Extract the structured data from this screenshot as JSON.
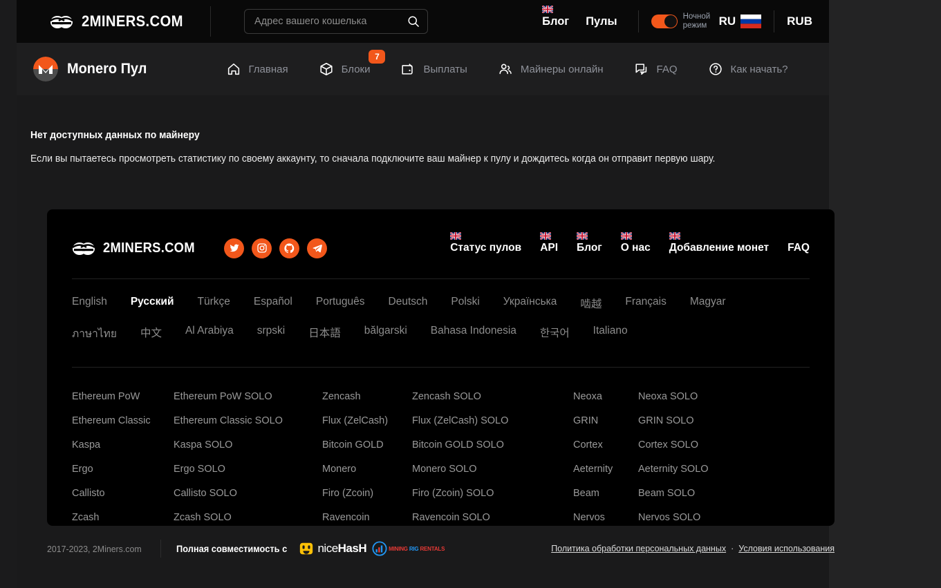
{
  "header": {
    "brand": "2MINERS.COM",
    "search": {
      "placeholder": "Адрес вашего кошелька",
      "value": ""
    },
    "links": [
      {
        "label": "Блог",
        "flag": "uk-flag-icon"
      },
      {
        "label": "Пулы",
        "flag": null
      }
    ],
    "night_mode": {
      "label_line1": "Ночной",
      "label_line2": "режим",
      "enabled": true,
      "accent": "#f2571b"
    },
    "language": "RU",
    "currency": "RUB"
  },
  "nav": {
    "pool_title": "Monero Пул",
    "coin_color": "#f2571b",
    "items": [
      {
        "label": "Главная",
        "icon": "home-icon",
        "badge": null
      },
      {
        "label": "Блоки",
        "icon": "cube-icon",
        "badge": "7"
      },
      {
        "label": "Выплаты",
        "icon": "wallet-icon",
        "badge": null
      },
      {
        "label": "Майнеры онлайн",
        "icon": "users-icon",
        "badge": null
      },
      {
        "label": "FAQ",
        "icon": "chat-icon",
        "badge": null
      },
      {
        "label": "Как начать?",
        "icon": "question-circle-icon",
        "badge": null
      }
    ]
  },
  "main": {
    "title": "Нет доступных данных по майнеру",
    "text": "Если вы пытаетесь просмотреть статистику по своему аккаунту, то сначала подключите ваш майнер к пулу и дождитесь когда он отправит первую шару."
  },
  "footer": {
    "brand": "2MINERS.COM",
    "socials": [
      "twitter-icon",
      "instagram-icon",
      "github-icon",
      "telegram-icon"
    ],
    "links": [
      {
        "label": "Статус пулов",
        "flag": "uk-flag-icon"
      },
      {
        "label": "API",
        "flag": "uk-flag-icon"
      },
      {
        "label": "Блог",
        "flag": "uk-flag-icon"
      },
      {
        "label": "О нас",
        "flag": "uk-flag-icon"
      },
      {
        "label": "Добавление монет",
        "flag": "uk-flag-icon"
      },
      {
        "label": "FAQ",
        "flag": null
      }
    ],
    "languages": [
      {
        "label": "English",
        "active": false
      },
      {
        "label": "Русский",
        "active": true
      },
      {
        "label": "Türkçe",
        "active": false
      },
      {
        "label": "Español",
        "active": false
      },
      {
        "label": "Português",
        "active": false
      },
      {
        "label": "Deutsch",
        "active": false
      },
      {
        "label": "Polski",
        "active": false
      },
      {
        "label": "Українська",
        "active": false
      },
      {
        "label": "啮越",
        "active": false
      },
      {
        "label": "Français",
        "active": false
      },
      {
        "label": "Magyar",
        "active": false
      },
      {
        "label": "ภาษาไทย",
        "active": false
      },
      {
        "label": "中文",
        "active": false
      },
      {
        "label": "Al Arabiya",
        "active": false
      },
      {
        "label": "srpski",
        "active": false
      },
      {
        "label": "日本語",
        "active": false
      },
      {
        "label": "bălgarski",
        "active": false
      },
      {
        "label": "Bahasa Indonesia",
        "active": false
      },
      {
        "label": "한국어",
        "active": false
      },
      {
        "label": "Italiano",
        "active": false
      }
    ],
    "coin_columns": [
      [
        "Ethereum PoW",
        "Ethereum Classic",
        "Kaspa",
        "Ergo",
        "Callisto",
        "Zcash"
      ],
      [
        "Ethereum PoW SOLO",
        "Ethereum Classic SOLO",
        "Kaspa SOLO",
        "Ergo SOLO",
        "Callisto SOLO",
        "Zcash SOLO"
      ],
      [
        "Zencash",
        "Flux (ZelCash)",
        "Bitcoin GOLD",
        "Monero",
        "Firo (Zcoin)",
        "Ravencoin"
      ],
      [
        "Zencash SOLO",
        "Flux (ZelCash) SOLO",
        "Bitcoin GOLD SOLO",
        "Monero SOLO",
        "Firo (Zcoin) SOLO",
        "Ravencoin SOLO"
      ],
      [
        "Neoxa",
        "GRIN",
        "Cortex",
        "Aeternity",
        "Beam",
        "Nervos"
      ],
      [
        "Neoxa SOLO",
        "GRIN SOLO",
        "Cortex SOLO",
        "Aeternity SOLO",
        "Beam SOLO",
        "Nervos SOLO"
      ]
    ]
  },
  "bottom": {
    "copyright": "2017-2023, 2Miners.com",
    "compat_label": "Полная совместимость с",
    "partners": [
      {
        "name": "nicehash-logo",
        "text_light": "nice",
        "text_bold": "HasH"
      },
      {
        "name": "miningrigrentals-logo",
        "text1": "MINING",
        "text2": "RIG",
        "text3": "RENTALS"
      }
    ],
    "legal": [
      {
        "label": "Политика обработки персональных данных"
      },
      {
        "label": "Условия использования"
      }
    ],
    "separator": "·"
  }
}
